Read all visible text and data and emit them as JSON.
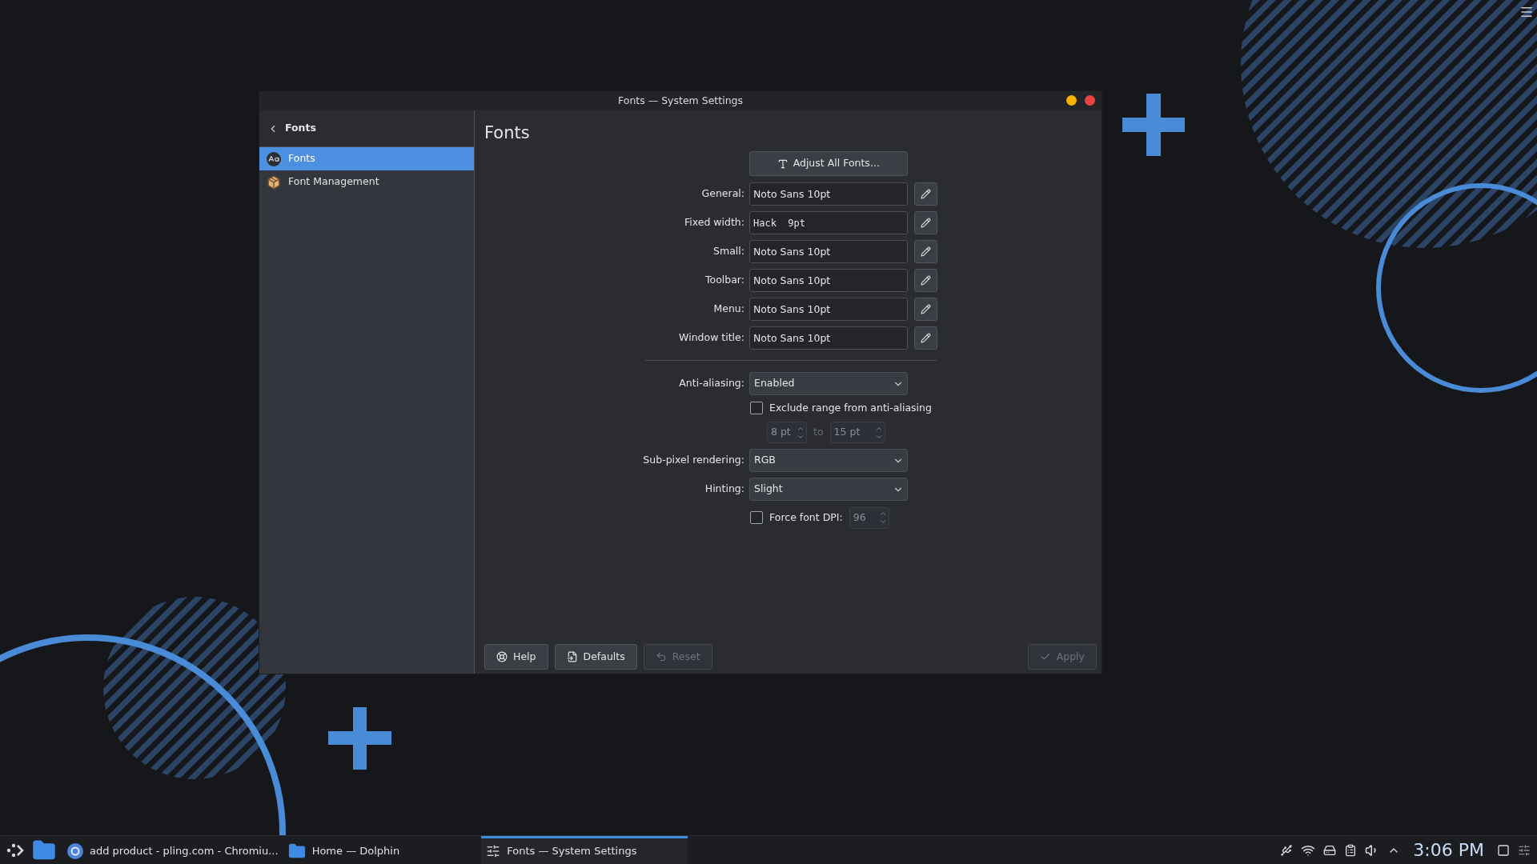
{
  "window": {
    "title": "Fonts — System Settings",
    "buttons": [
      {
        "kind": "minimize"
      },
      {
        "kind": "close"
      }
    ]
  },
  "sidebar": {
    "back_title": "Fonts",
    "items": [
      {
        "label": "Fonts",
        "kind": "fonts",
        "selected": true
      },
      {
        "label": "Font Management",
        "kind": "package",
        "selected": false
      }
    ]
  },
  "page": {
    "title": "Fonts",
    "adjust_button": "Adjust All Fonts…",
    "font_rows": [
      {
        "label": "General:",
        "value": "Noto Sans 10pt",
        "kind": "sans"
      },
      {
        "label": "Fixed width:",
        "value": "Hack  9pt",
        "kind": "mono"
      },
      {
        "label": "Small:",
        "value": "Noto Sans 10pt",
        "kind": "sans"
      },
      {
        "label": "Toolbar:",
        "value": "Noto Sans 10pt",
        "kind": "sans"
      },
      {
        "label": "Menu:",
        "value": "Noto Sans 10pt",
        "kind": "sans"
      },
      {
        "label": "Window title:",
        "value": "Noto Sans 10pt",
        "kind": "sans"
      }
    ],
    "anti_aliasing": {
      "label": "Anti-aliasing:",
      "value": "Enabled"
    },
    "exclude_range": {
      "label": "Exclude range from anti-aliasing",
      "checked": false,
      "from": "8 pt",
      "to_label": "to",
      "to": "15 pt",
      "disabled": true
    },
    "subpixel": {
      "label": "Sub-pixel rendering:",
      "value": "RGB"
    },
    "hinting": {
      "label": "Hinting:",
      "value": "Slight"
    },
    "force_dpi": {
      "label": "Force font DPI:",
      "checked": false,
      "value": "96",
      "disabled": true
    }
  },
  "footer_buttons": [
    {
      "label": "Help",
      "kind": "help",
      "disabled": false
    },
    {
      "label": "Defaults",
      "kind": "defaults",
      "disabled": false
    },
    {
      "label": "Reset",
      "kind": "reset",
      "disabled": true
    },
    {
      "label": "Apply",
      "kind": "apply",
      "disabled": true
    }
  ],
  "taskbar": {
    "tasks": [
      {
        "label": "add product - pling.com - Chromiu...",
        "kind": "browser",
        "selected": false
      },
      {
        "label": "Home — Dolphin",
        "kind": "folder",
        "selected": false
      },
      {
        "label": "Fonts  — System Settings",
        "kind": "settings",
        "selected": true
      }
    ],
    "clock": "3:06 PM"
  }
}
